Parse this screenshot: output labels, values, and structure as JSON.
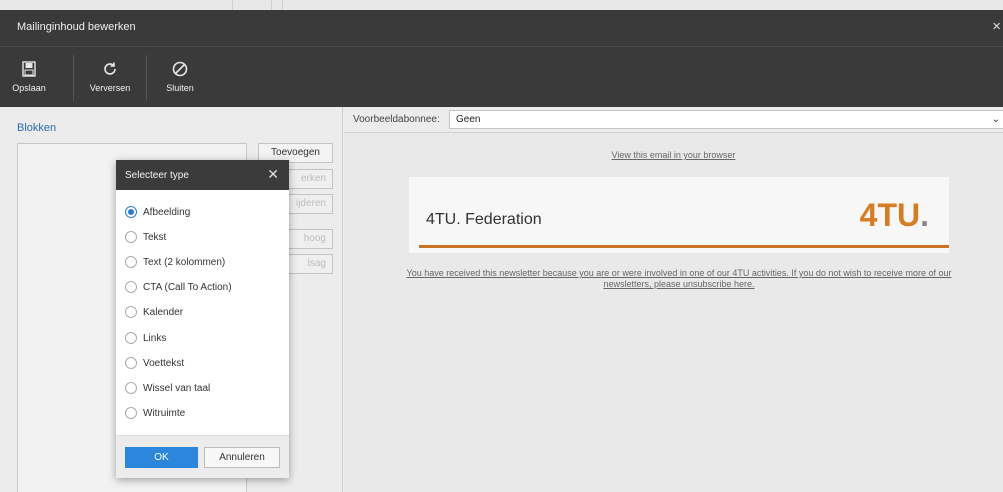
{
  "window": {
    "title": "Mailinginhoud bewerken",
    "close_glyph": "×"
  },
  "toolbar": {
    "save_label": "Opslaan",
    "refresh_label": "Verversen",
    "close_label": "Sluiten",
    "icons": [
      "save-icon",
      "refresh-icon",
      "cancel-icon"
    ]
  },
  "left": {
    "heading": "Blokken",
    "buttons": {
      "add": "Toevoegen",
      "edit": "erken",
      "delete": "ijderen",
      "up": "hoog",
      "down": "lsag"
    }
  },
  "right": {
    "subscriber_label": "Voorbeeldabonnee:",
    "subscriber_value": "Geen",
    "view_in_browser": "View this email in your browser",
    "federation_name": "4TU. Federation",
    "logo_text": "4TU",
    "logo_dot": ".",
    "newsletter_text": "You have received this newsletter because you are or were involved in one of our 4TU activities. If you do not wish to receive more of our newsletters, please unsubscribe here."
  },
  "dialog": {
    "title": "Selecteer type",
    "close_glyph": "✕",
    "options": [
      {
        "label": "Afbeelding",
        "checked": true
      },
      {
        "label": "Tekst",
        "checked": false
      },
      {
        "label": "Text (2 kolommen)",
        "checked": false
      },
      {
        "label": "CTA (Call To Action)",
        "checked": false
      },
      {
        "label": "Kalender",
        "checked": false
      },
      {
        "label": "Links",
        "checked": false
      },
      {
        "label": "Voettekst",
        "checked": false
      },
      {
        "label": "Wissel van taal",
        "checked": false
      },
      {
        "label": "Witruimte",
        "checked": false
      }
    ],
    "ok_label": "OK",
    "cancel_label": "Annuleren"
  },
  "colors": {
    "accent_blue": "#2b86dc",
    "brand_orange": "#d77c21",
    "dark_bar": "#3a3a3a",
    "heading_blue": "#2c6cb0"
  }
}
